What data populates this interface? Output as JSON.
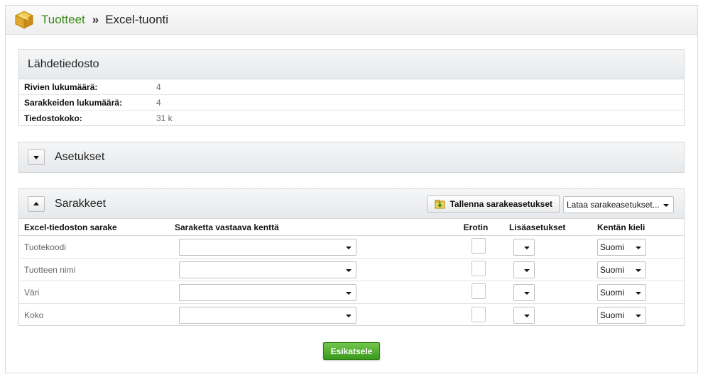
{
  "breadcrumb": {
    "parent": "Tuotteet",
    "separator": "»",
    "current": "Excel-tuonti"
  },
  "source": {
    "title": "Lähdetiedosto",
    "rows": [
      {
        "label": "Rivien lukumäärä:",
        "value": "4"
      },
      {
        "label": "Sarakkeiden lukumäärä:",
        "value": "4"
      },
      {
        "label": "Tiedostokoko:",
        "value": "31 k"
      }
    ]
  },
  "settings": {
    "title": "Asetukset"
  },
  "columns": {
    "title": "Sarakkeet",
    "save_label": "Tallenna sarakeasetukset",
    "load_label": "Lataa sarakeasetukset...",
    "headers": {
      "excel_column": "Excel-tiedoston sarake",
      "field": "Saraketta vastaava kenttä",
      "separator": "Erotin",
      "extra": "Lisäasetukset",
      "language": "Kentän kieli"
    },
    "rows": [
      {
        "name": "Tuotekoodi",
        "language": "Suomi"
      },
      {
        "name": "Tuotteen nimi",
        "language": "Suomi"
      },
      {
        "name": "Väri",
        "language": "Suomi"
      },
      {
        "name": "Koko",
        "language": "Suomi"
      }
    ]
  },
  "preview_label": "Esikatsele",
  "colors": {
    "accent_green": "#3a8a1a",
    "button_green": "#4aa825"
  }
}
